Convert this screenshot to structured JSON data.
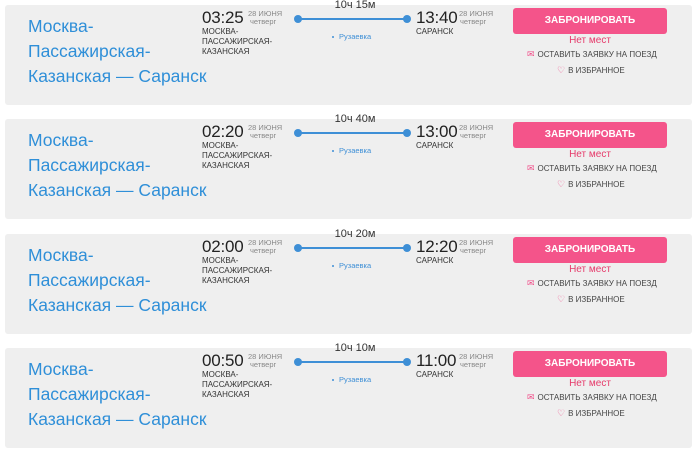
{
  "trains": [
    {
      "route": "Москва-Пассажирская-Казанская — Саранск",
      "departure": {
        "time": "03:25",
        "date": "28 июня",
        "weekday": "четверг",
        "station": "Москва-Пассажирская-Казанская"
      },
      "arrival": {
        "time": "13:40",
        "date": "28 июня",
        "weekday": "четверг",
        "station": "Саранск"
      },
      "duration": "10ч 15м",
      "stop": "Рузаевка",
      "book_label": "Забронировать",
      "availability": "Нет мест",
      "request_label": "Оставить заявку на поезд",
      "favorite_label": "В избранное"
    },
    {
      "route": "Москва-Пассажирская-Казанская — Саранск",
      "departure": {
        "time": "02:20",
        "date": "28 июня",
        "weekday": "четверг",
        "station": "Москва-Пассажирская-Казанская"
      },
      "arrival": {
        "time": "13:00",
        "date": "28 июня",
        "weekday": "четверг",
        "station": "Саранск"
      },
      "duration": "10ч 40м",
      "stop": "Рузаевка",
      "book_label": "Забронировать",
      "availability": "Нет мест",
      "request_label": "Оставить заявку на поезд",
      "favorite_label": "В избранное"
    },
    {
      "route": "Москва-Пассажирская-Казанская — Саранск",
      "departure": {
        "time": "02:00",
        "date": "28 июня",
        "weekday": "четверг",
        "station": "Москва-Пассажирская-Казанская"
      },
      "arrival": {
        "time": "12:20",
        "date": "28 июня",
        "weekday": "четверг",
        "station": "Саранск"
      },
      "duration": "10ч 20м",
      "stop": "Рузаевка",
      "book_label": "Забронировать",
      "availability": "Нет мест",
      "request_label": "Оставить заявку на поезд",
      "favorite_label": "В избранное"
    },
    {
      "route": "Москва-Пассажирская-Казанская — Саранск",
      "departure": {
        "time": "00:50",
        "date": "28 июня",
        "weekday": "четверг",
        "station": "Москва-Пассажирская-Казанская"
      },
      "arrival": {
        "time": "11:00",
        "date": "28 июня",
        "weekday": "четверг",
        "station": "Саранск"
      },
      "duration": "10ч 10м",
      "stop": "Рузаевка",
      "book_label": "Забронировать",
      "availability": "Нет мест",
      "request_label": "Оставить заявку на поезд",
      "favorite_label": "В избранное"
    }
  ],
  "colors": {
    "accent": "#f4548a",
    "link": "#2f8fd8",
    "card_bg": "#efefef"
  },
  "icons": {
    "request": "envelope-icon",
    "favorite": "heart-icon"
  }
}
